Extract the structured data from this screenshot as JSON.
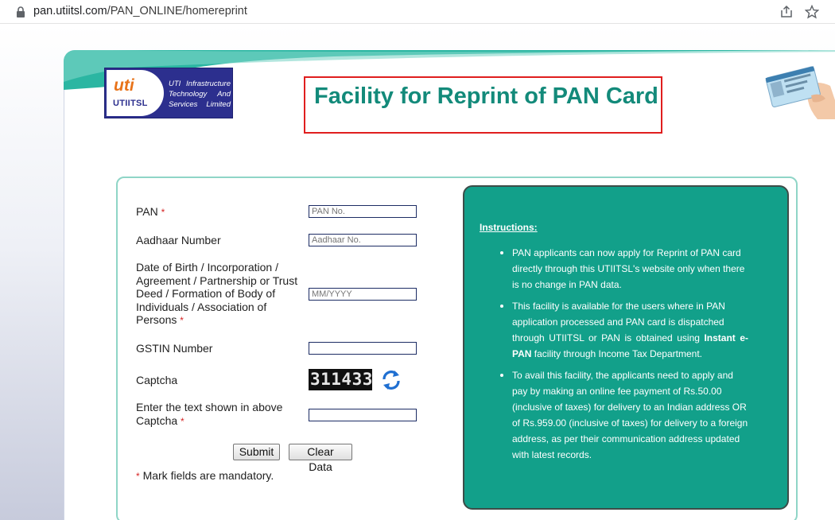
{
  "browser": {
    "url_host": "pan.utiitsl.com",
    "url_path": "/PAN_ONLINE/homereprint",
    "icons": [
      "lock-icon",
      "share-icon",
      "star-icon"
    ]
  },
  "logo": {
    "uti": "uti",
    "utiitsl": "UTIITSL",
    "line1": "UTI Infrastructure",
    "line2": "Technology And",
    "line3": "Services Limited"
  },
  "page_title": "Facility for Reprint of PAN Card",
  "form": {
    "pan_label": "PAN",
    "pan_placeholder": "PAN No.",
    "aadhaar_label": "Aadhaar Number",
    "aadhaar_placeholder": "Aadhaar No.",
    "dob_label_lines": [
      "Date of Birth / Incorporation /",
      "Agreement / Partnership or Trust",
      "Deed / Formation of Body of",
      "Individuals / Association of",
      "Persons"
    ],
    "dob_placeholder": "MM/YYYY",
    "gstin_label": "GSTIN Number",
    "gstin_value": "",
    "captcha_label": "Captcha",
    "captcha_text": "311433",
    "captcha_entry_label_lines": [
      "Enter the text shown in above",
      "Captcha"
    ],
    "captcha_entry_value": "",
    "required_marker": "*",
    "submit_label": "Submit",
    "clear_label": "Clear Data",
    "mandatory_note": "Mark fields are mandatory."
  },
  "instructions": {
    "title": "Instructions:",
    "items": [
      {
        "lines": [
          "PAN applicants can now apply for Reprint of PAN card",
          "directly through this UTIITSL's website only when there",
          "is no change in PAN data."
        ]
      },
      {
        "lines": [
          "This facility is available for the users where in PAN",
          "application processed and PAN card is dispatched",
          "through UTIITSL or PAN is obtained using"
        ],
        "bold1": "Instant e-",
        "bold2": "PAN",
        "tail": " facility through Income Tax Department."
      },
      {
        "lines": [
          "To avail this facility, the applicants need to apply and",
          "pay by making an online fee payment of Rs.50.00",
          "(inclusive of taxes) for delivery to an Indian address OR",
          "of Rs.959.00 (inclusive of taxes) for delivery to a foreign",
          "address, as per their communication address updated",
          "with latest records."
        ]
      }
    ]
  },
  "colors": {
    "title_color": "#138a7a",
    "instructions_bg": "#12a08a",
    "title_border": "#e01e1e",
    "logo_bg": "#2c2f8e",
    "logo_accent": "#e8731a"
  }
}
